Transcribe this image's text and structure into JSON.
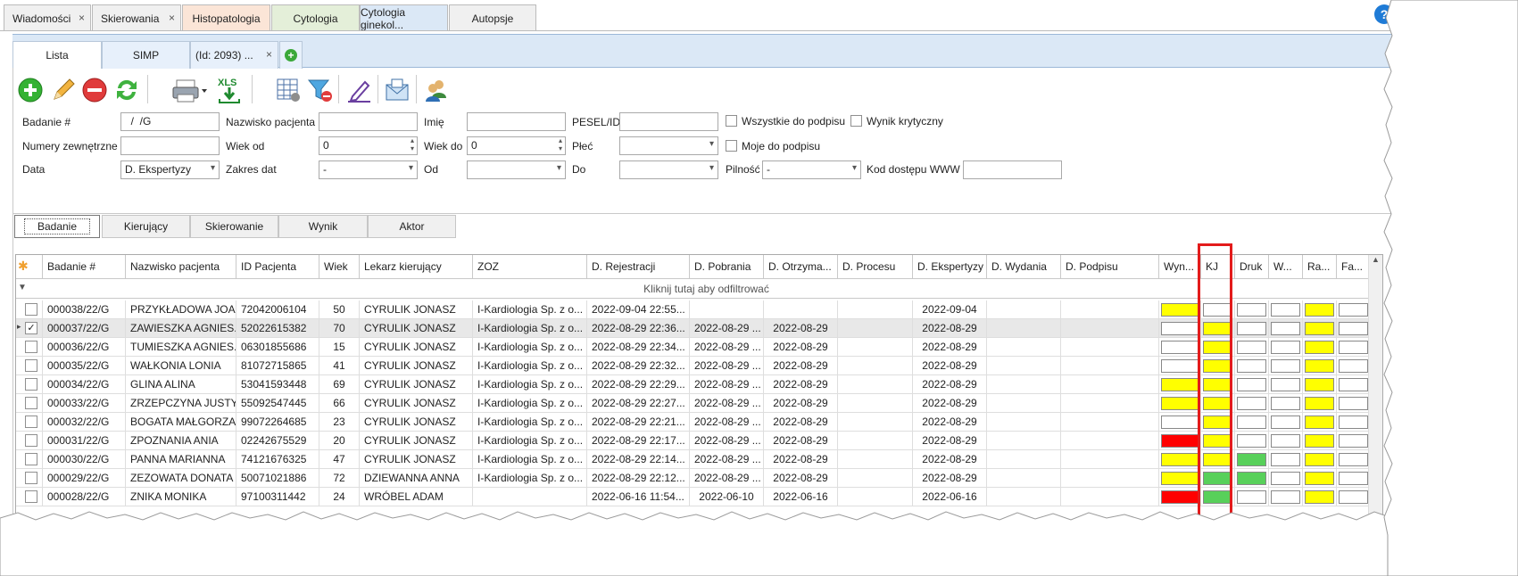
{
  "top_tabs": [
    {
      "label": "Wiadomości",
      "closable": true
    },
    {
      "label": "Skierowania",
      "closable": true
    },
    {
      "label": "Histopatologia",
      "closable": false
    },
    {
      "label": "Cytologia",
      "closable": false
    },
    {
      "label": "Cytologia ginekol...",
      "closable": false
    },
    {
      "label": "Autopsje",
      "closable": false
    }
  ],
  "sub_tabs": [
    {
      "label": "Lista"
    },
    {
      "label": "SIMP"
    },
    {
      "label": "(Id: 2093) ..."
    }
  ],
  "filters": {
    "badanie_label": "Badanie #",
    "badanie_value": "  /  /G",
    "nazwisko_label": "Nazwisko pacjenta",
    "nazwisko_value": "",
    "imie_label": "Imię",
    "imie_value": "",
    "pesel_label": "PESEL/ID",
    "pesel_value": "",
    "wszystkie_label": "Wszystkie do podpisu",
    "wynik_kryt_label": "Wynik krytyczny",
    "numery_label": "Numery zewnętrzne",
    "numery_value": "",
    "wiek_od_label": "Wiek od",
    "wiek_od_value": "0",
    "wiek_do_label": "Wiek do",
    "wiek_do_value": "0",
    "plec_label": "Płeć",
    "plec_value": "",
    "moje_label": "Moje do podpisu",
    "data_label": "Data",
    "data_value": "D. Ekspertyzy",
    "zakres_label": "Zakres dat",
    "zakres_value": "-",
    "od_label": "Od",
    "od_value": "",
    "do_label": "Do",
    "do_value": "",
    "pilnosc_label": "Pilność",
    "pilnosc_value": "-",
    "kod_label": "Kod dostępu WWW",
    "kod_value": ""
  },
  "filter_tabs": [
    "Badanie",
    "Kierujący",
    "Skierowanie",
    "Wynik",
    "Aktor"
  ],
  "grid": {
    "columns": [
      "Badanie #",
      "Nazwisko pacjenta",
      "ID Pacjenta",
      "Wiek",
      "Lekarz kierujący",
      "ZOZ",
      "D. Rejestracji",
      "D. Pobrania",
      "D. Otrzyma...",
      "D. Procesu",
      "D. Ekspertyzy",
      "D. Wydania",
      "D. Podpisu",
      "Wyn...",
      "KJ",
      "Druk",
      "W...",
      "Ra...",
      "Fa..."
    ],
    "filter_hint": "Kliknij tutaj aby odfiltrować",
    "rows": [
      {
        "checked": false,
        "c": [
          "000038/22/G",
          "PRZYKŁADOWA JOA...",
          "72042006104",
          "50",
          "CYRULIK JONASZ",
          "I-Kardiologia Sp. z o...",
          "2022-09-04 22:55...",
          "",
          "",
          "",
          "2022-09-04",
          "",
          ""
        ],
        "ind": [
          "y",
          "w",
          "w",
          "w",
          "y",
          "w"
        ]
      },
      {
        "checked": true,
        "c": [
          "000037/22/G",
          "ZAWIESZKA AGNIES...",
          "52022615382",
          "70",
          "CYRULIK JONASZ",
          "I-Kardiologia Sp. z o...",
          "2022-08-29 22:36...",
          "2022-08-29 ...",
          "2022-08-29",
          "",
          "2022-08-29",
          "",
          ""
        ],
        "ind": [
          "w",
          "y",
          "w",
          "w",
          "y",
          "w"
        ]
      },
      {
        "checked": false,
        "c": [
          "000036/22/G",
          "TUMIESZKA AGNIES...",
          "06301855686",
          "15",
          "CYRULIK JONASZ",
          "I-Kardiologia Sp. z o...",
          "2022-08-29 22:34...",
          "2022-08-29 ...",
          "2022-08-29",
          "",
          "2022-08-29",
          "",
          ""
        ],
        "ind": [
          "w",
          "y",
          "w",
          "w",
          "y",
          "w"
        ]
      },
      {
        "checked": false,
        "c": [
          "000035/22/G",
          "WAŁKONIA LONIA",
          "81072715865",
          "41",
          "CYRULIK JONASZ",
          "I-Kardiologia Sp. z o...",
          "2022-08-29 22:32...",
          "2022-08-29 ...",
          "2022-08-29",
          "",
          "2022-08-29",
          "",
          ""
        ],
        "ind": [
          "w",
          "y",
          "w",
          "w",
          "y",
          "w"
        ]
      },
      {
        "checked": false,
        "c": [
          "000034/22/G",
          "GLINA ALINA",
          "53041593448",
          "69",
          "CYRULIK JONASZ",
          "I-Kardiologia Sp. z o...",
          "2022-08-29 22:29...",
          "2022-08-29 ...",
          "2022-08-29",
          "",
          "2022-08-29",
          "",
          ""
        ],
        "ind": [
          "y",
          "y",
          "w",
          "w",
          "y",
          "w"
        ]
      },
      {
        "checked": false,
        "c": [
          "000033/22/G",
          "ZRZEPCZYNA JUSTYNA",
          "55092547445",
          "66",
          "CYRULIK JONASZ",
          "I-Kardiologia Sp. z o...",
          "2022-08-29 22:27...",
          "2022-08-29 ...",
          "2022-08-29",
          "",
          "2022-08-29",
          "",
          ""
        ],
        "ind": [
          "y",
          "y",
          "w",
          "w",
          "y",
          "w"
        ]
      },
      {
        "checked": false,
        "c": [
          "000032/22/G",
          "BOGATA MAŁGORZA...",
          "99072264685",
          "23",
          "CYRULIK JONASZ",
          "I-Kardiologia Sp. z o...",
          "2022-08-29 22:21...",
          "2022-08-29 ...",
          "2022-08-29",
          "",
          "2022-08-29",
          "",
          ""
        ],
        "ind": [
          "w",
          "y",
          "w",
          "w",
          "y",
          "w"
        ]
      },
      {
        "checked": false,
        "c": [
          "000031/22/G",
          "ZPOZNANIA ANIA",
          "02242675529",
          "20",
          "CYRULIK JONASZ",
          "I-Kardiologia Sp. z o...",
          "2022-08-29 22:17...",
          "2022-08-29 ...",
          "2022-08-29",
          "",
          "2022-08-29",
          "",
          ""
        ],
        "ind": [
          "r",
          "y",
          "w",
          "w",
          "y",
          "w"
        ]
      },
      {
        "checked": false,
        "c": [
          "000030/22/G",
          "PANNA MARIANNA",
          "74121676325",
          "47",
          "CYRULIK JONASZ",
          "I-Kardiologia Sp. z o...",
          "2022-08-29 22:14...",
          "2022-08-29 ...",
          "2022-08-29",
          "",
          "2022-08-29",
          "",
          ""
        ],
        "ind": [
          "y",
          "y",
          "g",
          "w",
          "y",
          "w"
        ]
      },
      {
        "checked": false,
        "c": [
          "000029/22/G",
          "ZEZOWATA DONATA",
          "50071021886",
          "72",
          "DZIEWANNA ANNA",
          "I-Kardiologia Sp. z o...",
          "2022-08-29 22:12...",
          "2022-08-29 ...",
          "2022-08-29",
          "",
          "2022-08-29",
          "",
          ""
        ],
        "ind": [
          "y",
          "g",
          "g",
          "w",
          "y",
          "w"
        ]
      },
      {
        "checked": false,
        "c": [
          "000028/22/G",
          "ZNIKA MONIKA",
          "97100311442",
          "24",
          "WRÓBEL ADAM",
          "",
          "2022-06-16 11:54...",
          "2022-06-10",
          "2022-06-16",
          "",
          "2022-06-16",
          "",
          ""
        ],
        "ind": [
          "r",
          "g",
          "w",
          "w",
          "y",
          "w"
        ]
      }
    ]
  },
  "colors": {
    "yellow": "#ffff00",
    "red": "#ff0000",
    "green": "#58d05a",
    "highlight": "#e31b1b",
    "tabblue": "#dbe8f6"
  }
}
